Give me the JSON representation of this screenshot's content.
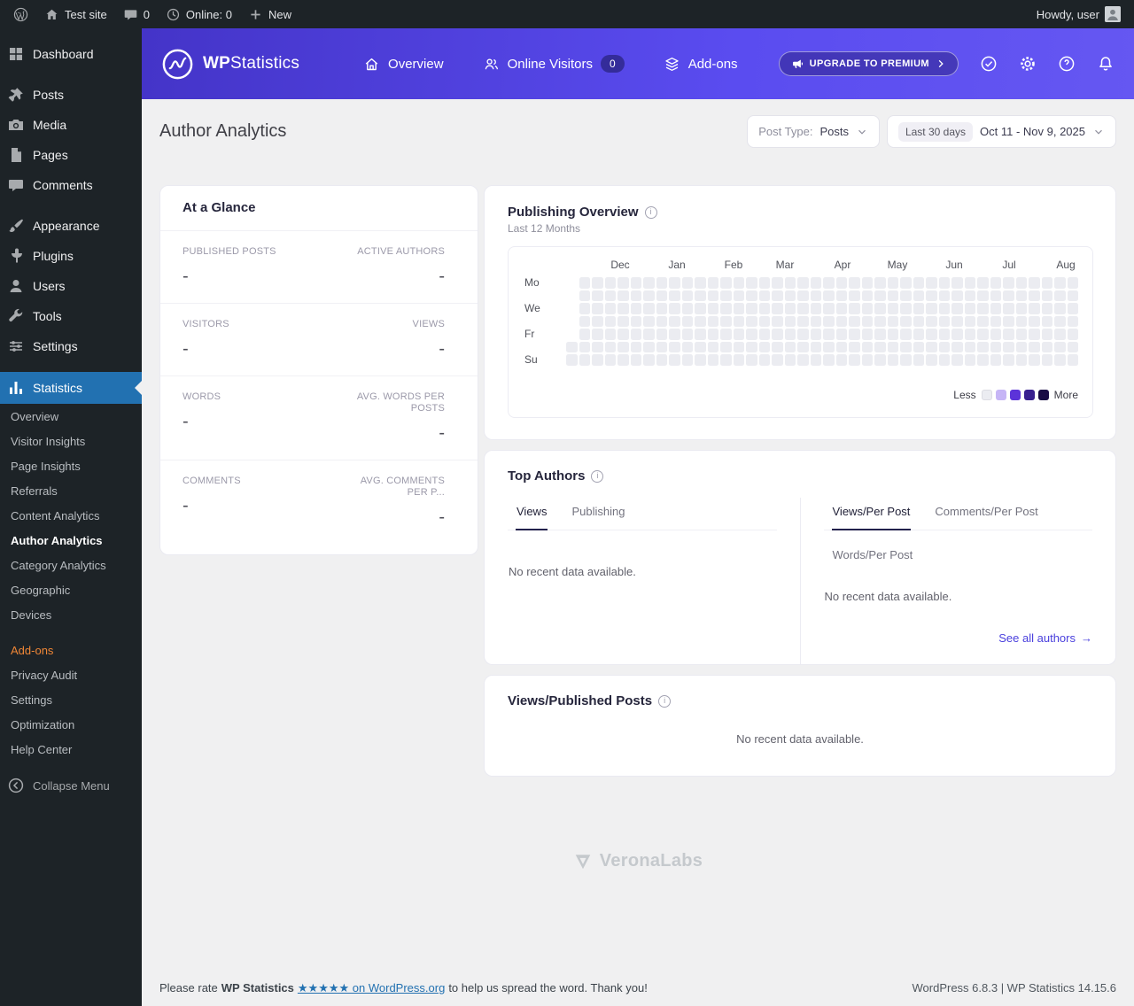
{
  "admin_bar": {
    "site_name": "Test site",
    "comments_count": "0",
    "online_label": "Online: 0",
    "new_label": "New",
    "howdy_label": "Howdy, user"
  },
  "sidebar": {
    "items": [
      {
        "label": "Dashboard",
        "icon": "dashboard-icon",
        "separator_after": true
      },
      {
        "label": "Posts",
        "icon": "pin-icon"
      },
      {
        "label": "Media",
        "icon": "camera-icon"
      },
      {
        "label": "Pages",
        "icon": "pages-icon"
      },
      {
        "label": "Comments",
        "icon": "comment-icon",
        "separator_after": true
      },
      {
        "label": "Appearance",
        "icon": "appearance-icon"
      },
      {
        "label": "Plugins",
        "icon": "plugin-icon"
      },
      {
        "label": "Users",
        "icon": "user-icon"
      },
      {
        "label": "Tools",
        "icon": "tools-icon"
      },
      {
        "label": "Settings",
        "icon": "settings-sliders-icon",
        "separator_after": true
      },
      {
        "label": "Statistics",
        "icon": "chart-icon",
        "active": true
      }
    ],
    "submenu": [
      {
        "label": "Overview"
      },
      {
        "label": "Visitor Insights"
      },
      {
        "label": "Page Insights"
      },
      {
        "label": "Referrals"
      },
      {
        "label": "Content Analytics"
      },
      {
        "label": "Author Analytics",
        "active": true
      },
      {
        "label": "Category Analytics"
      },
      {
        "label": "Geographic"
      },
      {
        "label": "Devices"
      },
      {
        "label": "Add-ons",
        "accent": true,
        "gap_before": true
      },
      {
        "label": "Privacy Audit"
      },
      {
        "label": "Settings"
      },
      {
        "label": "Optimization"
      },
      {
        "label": "Help Center"
      }
    ],
    "collapse_label": "Collapse Menu"
  },
  "header": {
    "brand_bold": "WP",
    "brand_rest": "Statistics",
    "nav": [
      {
        "label": "Overview",
        "icon": "home-outline-icon"
      },
      {
        "label": "Online Visitors",
        "icon": "visitors-icon",
        "badge": "0"
      },
      {
        "label": "Add-ons",
        "icon": "addons-icon"
      }
    ],
    "upgrade_label": "UPGRADE TO PREMIUM"
  },
  "page": {
    "title": "Author Analytics",
    "filters": {
      "post_type_label": "Post Type:",
      "post_type_value": "Posts",
      "date_chip": "Last 30 days",
      "date_value": "Oct 11 - Nov 9, 2025"
    }
  },
  "glance": {
    "title": "At a Glance",
    "metrics": [
      {
        "label": "PUBLISHED POSTS",
        "value": "-"
      },
      {
        "label": "ACTIVE AUTHORS",
        "value": "-"
      },
      {
        "label": "VISITORS",
        "value": "-"
      },
      {
        "label": "VIEWS",
        "value": "-"
      },
      {
        "label": "WORDS",
        "value": "-"
      },
      {
        "label": "AVG. WORDS PER POSTS",
        "value": "-"
      },
      {
        "label": "COMMENTS",
        "value": "-"
      },
      {
        "label": "AVG. COMMENTS PER P...",
        "value": "-"
      }
    ]
  },
  "publishing": {
    "title": "Publishing Overview",
    "subtitle": "Last 12 Months",
    "months": [
      "Dec",
      "Jan",
      "Feb",
      "Mar",
      "Apr",
      "May",
      "Jun",
      "Jul",
      "Aug"
    ],
    "month_offsets": [
      61,
      125,
      189,
      247,
      312,
      374,
      438,
      500,
      564
    ],
    "day_labels": [
      {
        "label": "Mo",
        "row": 0
      },
      {
        "label": "We",
        "row": 2
      },
      {
        "label": "Fr",
        "row": 4
      },
      {
        "label": "Su",
        "row": 6
      }
    ],
    "weeks": 40,
    "first_week_start_row": 5,
    "cell_color": "#ebecf1",
    "legend": {
      "less": "Less",
      "more": "More",
      "colors": [
        "#ebecf1",
        "#c6b5f6",
        "#5c33d9",
        "#38208f",
        "#190b45"
      ]
    }
  },
  "top_authors": {
    "title": "Top Authors",
    "left_tabs": [
      {
        "label": "Views",
        "active": true
      },
      {
        "label": "Publishing"
      }
    ],
    "right_tabs_row1": [
      {
        "label": "Views/Per Post",
        "active": true
      },
      {
        "label": "Comments/Per Post"
      }
    ],
    "right_tabs_row2": [
      {
        "label": "Words/Per Post"
      }
    ],
    "left_empty": "No recent data available.",
    "right_empty": "No recent data available.",
    "see_all_label": "See all authors",
    "see_all_arrow": "→"
  },
  "views_published": {
    "title": "Views/Published Posts",
    "empty": "No recent data available."
  },
  "watermark": "VeronaLabs",
  "footer": {
    "pre": "Please rate",
    "brand": "WP Statistics",
    "link": "★★★★★ on WordPress.org",
    "post": "to help us spread the word. Thank you!",
    "right": "WordPress 6.8.3 | WP Statistics 14.15.6"
  },
  "colors": {
    "admin_bar_bg": "#1d2327",
    "active_menu_blue": "#2271b1",
    "submenu_accent_orange": "#ef8636",
    "header_gradient_start": "#4434c8",
    "header_gradient_end": "#6557f2",
    "link_blue": "#2271b1",
    "primary_indigo": "#4a40dd",
    "heatmap_cell": "#ebecf1"
  }
}
